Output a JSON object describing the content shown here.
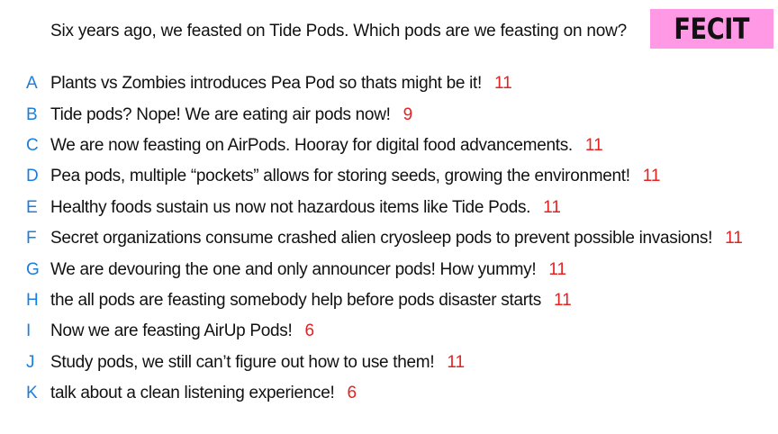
{
  "question": "Six years ago, we feasted on Tide Pods. Which pods are we feasting on now?",
  "brand": "FECIT",
  "colors": {
    "brand_bg": "#ff99e6",
    "letter": "#1a7ee0",
    "count": "#e32222",
    "text": "#111111"
  },
  "answers": [
    {
      "letter": "A",
      "text": "Plants vs Zombies introduces Pea Pod so thats might be it!",
      "count": "11"
    },
    {
      "letter": "B",
      "text": "Tide pods? Nope! We are eating air pods now!",
      "count": "9"
    },
    {
      "letter": "C",
      "text": "We are now feasting on AirPods. Hooray for digital food advancements.",
      "count": "11"
    },
    {
      "letter": "D",
      "text": "Pea pods, multiple “pockets” allows for storing seeds, growing the environment!",
      "count": "11"
    },
    {
      "letter": "E",
      "text": "Healthy foods sustain us now not hazardous items like Tide Pods.",
      "count": "11"
    },
    {
      "letter": "F",
      "text": "Secret organizations consume crashed alien cryosleep pods to prevent possible invasions!",
      "count": "11"
    },
    {
      "letter": "G",
      "text": "We are devouring the one and only announcer pods! How yummy!",
      "count": "11"
    },
    {
      "letter": "H",
      "text": "the all pods are feasting somebody help before pods disaster starts",
      "count": "11"
    },
    {
      "letter": "I",
      "text": "Now we are feasting AirUp Pods!",
      "count": "6"
    },
    {
      "letter": "J",
      "text": "Study pods, we still can’t figure out how to use them!",
      "count": "11"
    },
    {
      "letter": "K",
      "text": "talk about a clean listening experience!",
      "count": "6"
    }
  ]
}
